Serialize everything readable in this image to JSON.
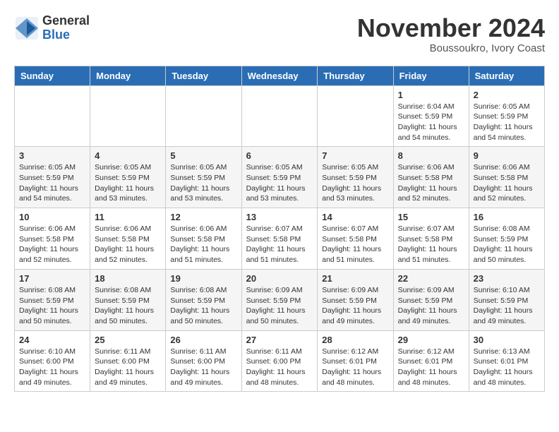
{
  "header": {
    "logo_general": "General",
    "logo_blue": "Blue",
    "month_year": "November 2024",
    "location": "Boussoukro, Ivory Coast"
  },
  "days_of_week": [
    "Sunday",
    "Monday",
    "Tuesday",
    "Wednesday",
    "Thursday",
    "Friday",
    "Saturday"
  ],
  "weeks": [
    [
      {
        "day": "",
        "info": ""
      },
      {
        "day": "",
        "info": ""
      },
      {
        "day": "",
        "info": ""
      },
      {
        "day": "",
        "info": ""
      },
      {
        "day": "",
        "info": ""
      },
      {
        "day": "1",
        "info": "Sunrise: 6:04 AM\nSunset: 5:59 PM\nDaylight: 11 hours and 54 minutes."
      },
      {
        "day": "2",
        "info": "Sunrise: 6:05 AM\nSunset: 5:59 PM\nDaylight: 11 hours and 54 minutes."
      }
    ],
    [
      {
        "day": "3",
        "info": "Sunrise: 6:05 AM\nSunset: 5:59 PM\nDaylight: 11 hours and 54 minutes."
      },
      {
        "day": "4",
        "info": "Sunrise: 6:05 AM\nSunset: 5:59 PM\nDaylight: 11 hours and 53 minutes."
      },
      {
        "day": "5",
        "info": "Sunrise: 6:05 AM\nSunset: 5:59 PM\nDaylight: 11 hours and 53 minutes."
      },
      {
        "day": "6",
        "info": "Sunrise: 6:05 AM\nSunset: 5:59 PM\nDaylight: 11 hours and 53 minutes."
      },
      {
        "day": "7",
        "info": "Sunrise: 6:05 AM\nSunset: 5:59 PM\nDaylight: 11 hours and 53 minutes."
      },
      {
        "day": "8",
        "info": "Sunrise: 6:06 AM\nSunset: 5:58 PM\nDaylight: 11 hours and 52 minutes."
      },
      {
        "day": "9",
        "info": "Sunrise: 6:06 AM\nSunset: 5:58 PM\nDaylight: 11 hours and 52 minutes."
      }
    ],
    [
      {
        "day": "10",
        "info": "Sunrise: 6:06 AM\nSunset: 5:58 PM\nDaylight: 11 hours and 52 minutes."
      },
      {
        "day": "11",
        "info": "Sunrise: 6:06 AM\nSunset: 5:58 PM\nDaylight: 11 hours and 52 minutes."
      },
      {
        "day": "12",
        "info": "Sunrise: 6:06 AM\nSunset: 5:58 PM\nDaylight: 11 hours and 51 minutes."
      },
      {
        "day": "13",
        "info": "Sunrise: 6:07 AM\nSunset: 5:58 PM\nDaylight: 11 hours and 51 minutes."
      },
      {
        "day": "14",
        "info": "Sunrise: 6:07 AM\nSunset: 5:58 PM\nDaylight: 11 hours and 51 minutes."
      },
      {
        "day": "15",
        "info": "Sunrise: 6:07 AM\nSunset: 5:58 PM\nDaylight: 11 hours and 51 minutes."
      },
      {
        "day": "16",
        "info": "Sunrise: 6:08 AM\nSunset: 5:59 PM\nDaylight: 11 hours and 50 minutes."
      }
    ],
    [
      {
        "day": "17",
        "info": "Sunrise: 6:08 AM\nSunset: 5:59 PM\nDaylight: 11 hours and 50 minutes."
      },
      {
        "day": "18",
        "info": "Sunrise: 6:08 AM\nSunset: 5:59 PM\nDaylight: 11 hours and 50 minutes."
      },
      {
        "day": "19",
        "info": "Sunrise: 6:08 AM\nSunset: 5:59 PM\nDaylight: 11 hours and 50 minutes."
      },
      {
        "day": "20",
        "info": "Sunrise: 6:09 AM\nSunset: 5:59 PM\nDaylight: 11 hours and 50 minutes."
      },
      {
        "day": "21",
        "info": "Sunrise: 6:09 AM\nSunset: 5:59 PM\nDaylight: 11 hours and 49 minutes."
      },
      {
        "day": "22",
        "info": "Sunrise: 6:09 AM\nSunset: 5:59 PM\nDaylight: 11 hours and 49 minutes."
      },
      {
        "day": "23",
        "info": "Sunrise: 6:10 AM\nSunset: 5:59 PM\nDaylight: 11 hours and 49 minutes."
      }
    ],
    [
      {
        "day": "24",
        "info": "Sunrise: 6:10 AM\nSunset: 6:00 PM\nDaylight: 11 hours and 49 minutes."
      },
      {
        "day": "25",
        "info": "Sunrise: 6:11 AM\nSunset: 6:00 PM\nDaylight: 11 hours and 49 minutes."
      },
      {
        "day": "26",
        "info": "Sunrise: 6:11 AM\nSunset: 6:00 PM\nDaylight: 11 hours and 49 minutes."
      },
      {
        "day": "27",
        "info": "Sunrise: 6:11 AM\nSunset: 6:00 PM\nDaylight: 11 hours and 48 minutes."
      },
      {
        "day": "28",
        "info": "Sunrise: 6:12 AM\nSunset: 6:01 PM\nDaylight: 11 hours and 48 minutes."
      },
      {
        "day": "29",
        "info": "Sunrise: 6:12 AM\nSunset: 6:01 PM\nDaylight: 11 hours and 48 minutes."
      },
      {
        "day": "30",
        "info": "Sunrise: 6:13 AM\nSunset: 6:01 PM\nDaylight: 11 hours and 48 minutes."
      }
    ]
  ]
}
